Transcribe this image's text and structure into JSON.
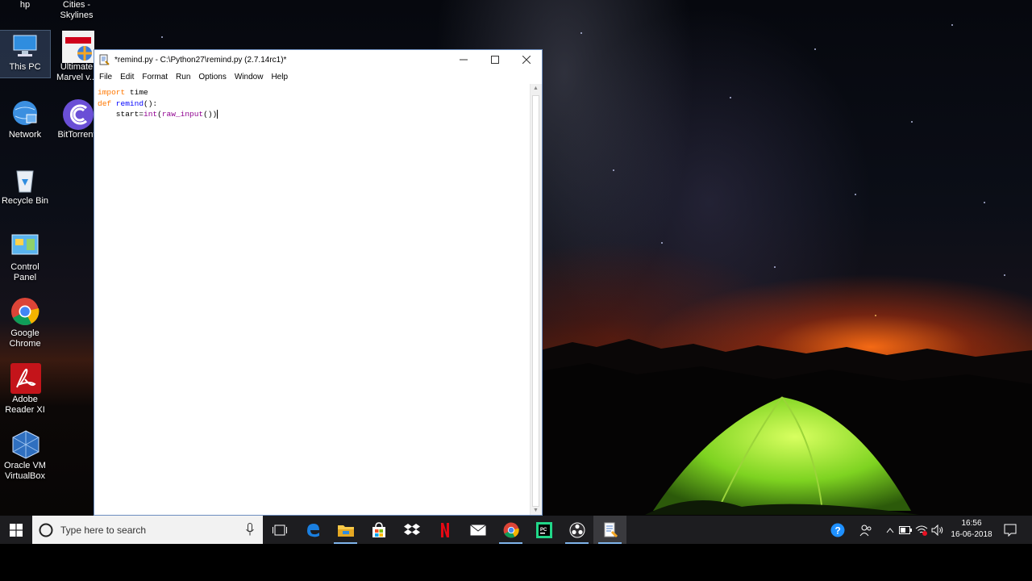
{
  "desktop": {
    "icons": [
      {
        "label": "hp",
        "icon": "hp-folder-icon"
      },
      {
        "label": "Cities - Skylines",
        "icon": "game-icon"
      },
      {
        "label": "This PC",
        "icon": "computer-icon"
      },
      {
        "label": "Ultimate Marvel v...",
        "icon": "marvel-game-icon"
      },
      {
        "label": "Network",
        "icon": "network-icon"
      },
      {
        "label": "BitTorrent",
        "icon": "bittorrent-icon"
      },
      {
        "label": "Recycle Bin",
        "icon": "recycle-bin-icon"
      },
      {
        "label": "Control Panel",
        "icon": "control-panel-icon"
      },
      {
        "label": "Google Chrome",
        "icon": "chrome-icon"
      },
      {
        "label": "Adobe Reader XI",
        "icon": "adobe-reader-icon"
      },
      {
        "label": "Oracle VM VirtualBox",
        "icon": "virtualbox-icon"
      }
    ]
  },
  "window": {
    "title": "*remind.py - C:\\Python27\\remind.py (2.7.14rc1)*",
    "menu": [
      "File",
      "Edit",
      "Format",
      "Run",
      "Options",
      "Window",
      "Help"
    ],
    "code": {
      "l1_kw": "import",
      "l1_rest": " time",
      "l2_kw": "def",
      "l2_fn": " remind",
      "l2_rest": "():",
      "l3_indent": "    start=",
      "l3_bi1": "int",
      "l3_p1": "(",
      "l3_bi2": "raw_input",
      "l3_p2": "())"
    }
  },
  "taskbar": {
    "search_placeholder": "Type here to search",
    "apps": [
      "task-view-icon",
      "edge-icon",
      "file-explorer-icon",
      "store-icon",
      "dropbox-icon",
      "netflix-icon",
      "mail-icon",
      "chrome-icon",
      "pycharm-icon",
      "obs-icon",
      "idle-icon"
    ],
    "clock_time": "16:56",
    "clock_date": "16-06-2018"
  },
  "colors": {
    "keyword": "#ff7700",
    "function": "#0000ff",
    "builtin": "#900090",
    "taskbar": "#1d1d20",
    "accent": "#7fb4ea"
  }
}
